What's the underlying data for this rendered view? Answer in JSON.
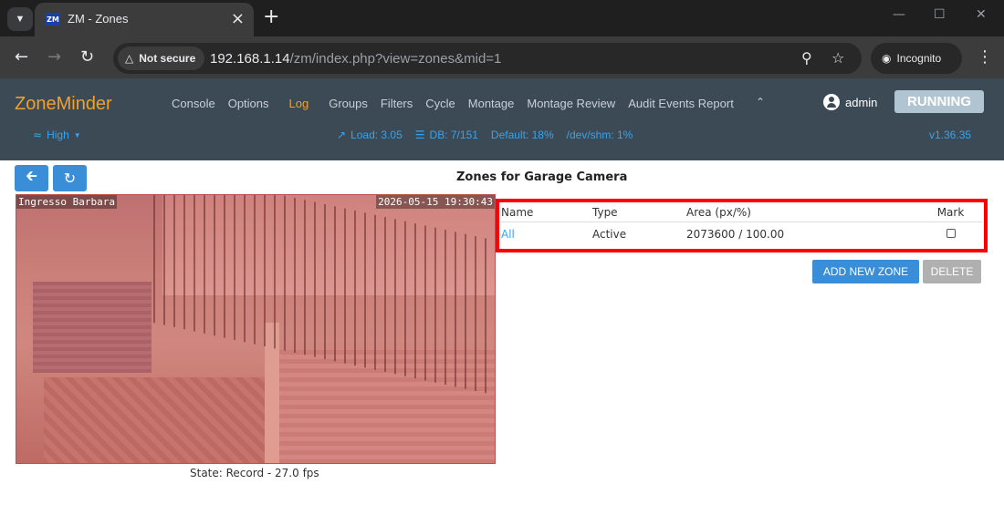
{
  "browser": {
    "tab_title": "ZM - Zones",
    "favicon_text": "ZM",
    "security_label": "Not secure",
    "url_host": "192.168.1.14",
    "url_path": "/zm/index.php?view=zones&mid=1",
    "incognito_label": "Incognito"
  },
  "zm": {
    "logo": "ZoneMinder",
    "menu": [
      "Console",
      "Options",
      "Log",
      "Groups",
      "Filters",
      "Cycle",
      "Montage",
      "Montage Review",
      "Audit Events Report"
    ],
    "active_menu": "Log",
    "user": "admin",
    "status": "RUNNING",
    "bandwidth": "High",
    "load": "Load: 3.05",
    "db": "DB: 7/151",
    "default_disk": "Default: 18%",
    "shm": "/dev/shm: 1%",
    "version": "v1.36.35"
  },
  "page": {
    "heading": "Zones for Garage Camera",
    "camera_label_left": "Ingresso Barbara",
    "camera_timestamp": "2026-05-15 19:30:43",
    "state": "State: Record - 27.0 fps"
  },
  "zones_table": {
    "headers": [
      "Name",
      "Type",
      "Area (px/%)",
      "Mark"
    ],
    "rows": [
      {
        "name": "All",
        "type": "Active",
        "area": "2073600 / 100.00",
        "mark": false
      }
    ]
  },
  "buttons": {
    "add_zone": "ADD NEW ZONE",
    "delete": "DELETE"
  },
  "colors": {
    "accent": "#3a8ed8",
    "highlight": "#ff0000",
    "logo": "#f0a030"
  }
}
